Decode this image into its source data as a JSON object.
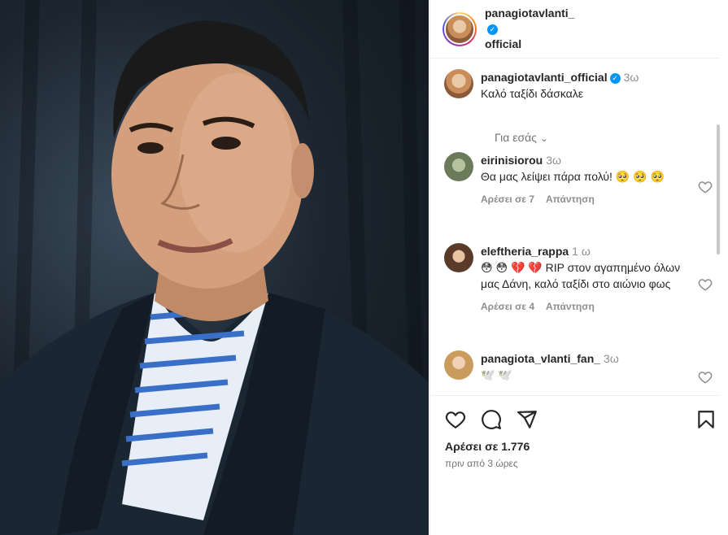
{
  "post": {
    "username_line1": "panagiotavlanti_",
    "username_line2": "official"
  },
  "caption": {
    "username": "panagiotavlanti_official",
    "time": "3ω",
    "text": "Καλό ταξίδι δάσκαλε",
    "for_you": "Για εσάς"
  },
  "comments": [
    {
      "username": "eirinisiorou",
      "time": "3ω",
      "text": "Θα μας λείψει πάρα πολύ! 🥺 🥺 🥺",
      "likes": "Αρέσει σε 7",
      "reply": "Απάντηση"
    },
    {
      "username": "eleftheria_rappa",
      "time": "1 ω",
      "text": "😳 😳 💔 💔 RIP στον αγαπημένο όλων μας Δάνη, καλό ταξίδι στο αιώνιο φως",
      "likes": "Αρέσει σε 4",
      "reply": "Απάντηση"
    },
    {
      "username": "panagiota_vlanti_fan_",
      "time": "3ω",
      "text": "🕊️ 🕊️"
    }
  ],
  "footer": {
    "likes": "Αρέσει σε 1.776",
    "time_ago": "πριν από 3 ώρες"
  },
  "colors": {
    "verified": "#0095f6",
    "muted": "#8e8e8e"
  }
}
